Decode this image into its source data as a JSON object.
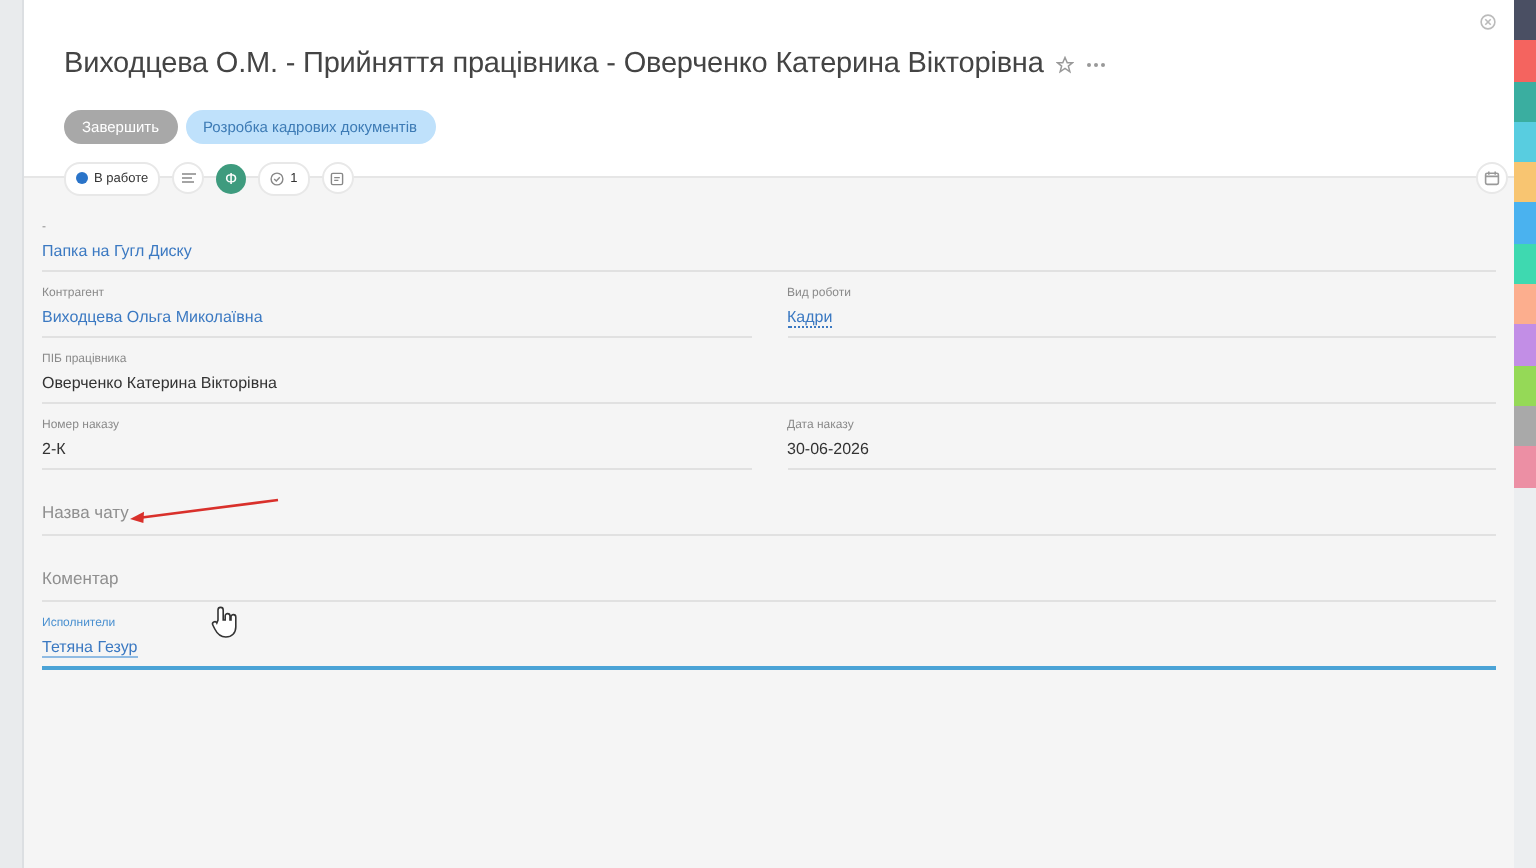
{
  "title": "Виходцева О.М. - Прийняття працівника - Оверченко Катерина Вікторівна",
  "buttons": [
    {
      "label": "Завершить",
      "disabled": true
    },
    {
      "label": "Розробка кадрових документів",
      "disabled": false
    }
  ],
  "status": {
    "label": "В работе",
    "color": "#2a74c9"
  },
  "avatar": "Ф",
  "checklist_count": "1",
  "rows": [
    {
      "cells": [
        {
          "kind": "link",
          "label": "-",
          "value": "Папка на Гугл Диску"
        }
      ]
    },
    {
      "cells": [
        {
          "kind": "link",
          "label": "Контрагент",
          "value": "Виходцева Ольга Миколаївна"
        },
        {
          "kind": "dotted-link",
          "label": "Вид роботи",
          "value": "Кадри"
        }
      ]
    },
    {
      "cells": [
        {
          "kind": "text",
          "label": "ПІБ працівника",
          "value": "Оверченко Катерина Вікторівна"
        }
      ]
    },
    {
      "cells": [
        {
          "kind": "text",
          "label": "Номер наказу",
          "value": "2-К"
        },
        {
          "kind": "text",
          "label": "Дата наказу",
          "value": "30-06-2026"
        }
      ]
    },
    {
      "cells": [
        {
          "kind": "empty",
          "placeholder": "Назва чату"
        }
      ]
    },
    {
      "cells": [
        {
          "kind": "empty",
          "placeholder": "Коментар"
        }
      ]
    },
    {
      "cells": [
        {
          "kind": "link",
          "label": "Исполнители",
          "value": "Тетяна Гезур",
          "focused": true
        }
      ]
    }
  ],
  "side_tabs": [
    {
      "color": "#4a4f63"
    },
    {
      "color": "#f4645f"
    },
    {
      "color": "#3aaea0"
    },
    {
      "color": "#58cde0"
    },
    {
      "color": "#f8c571"
    },
    {
      "color": "#4ab2ef"
    },
    {
      "color": "#3ed9b0"
    },
    {
      "color": "#fcae8e"
    },
    {
      "color": "#c28ee6"
    },
    {
      "color": "#95d957"
    },
    {
      "color": "#a9a9a9"
    },
    {
      "color": "#ec8fa4"
    }
  ]
}
